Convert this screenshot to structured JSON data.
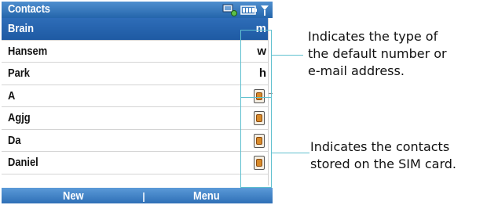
{
  "titlebar": {
    "title": "Contacts"
  },
  "contacts": [
    {
      "name": "Brain",
      "type": "m",
      "selected": true
    },
    {
      "name": "Hansem",
      "type": "w"
    },
    {
      "name": "Park",
      "type": "h"
    },
    {
      "name": "A",
      "sim_icon": "sim-card-icon"
    },
    {
      "name": "Agjg",
      "sim_icon": "sim-card-icon"
    },
    {
      "name": "Da",
      "sim_icon": "sim-card-icon"
    },
    {
      "name": "Daniel",
      "sim_icon": "sim-card-icon"
    }
  ],
  "softkeys": {
    "left": "New",
    "right": "Menu"
  },
  "annotations": {
    "type_note_line1": "Indicates the type of",
    "type_note_line2": "the default number or",
    "type_note_line3": "e-mail address.",
    "sim_note_line1": "Indicates the contacts",
    "sim_note_line2": "stored on the SIM card."
  },
  "colors": {
    "accent": "#2e6db8",
    "callout": "#5fc0cf"
  }
}
